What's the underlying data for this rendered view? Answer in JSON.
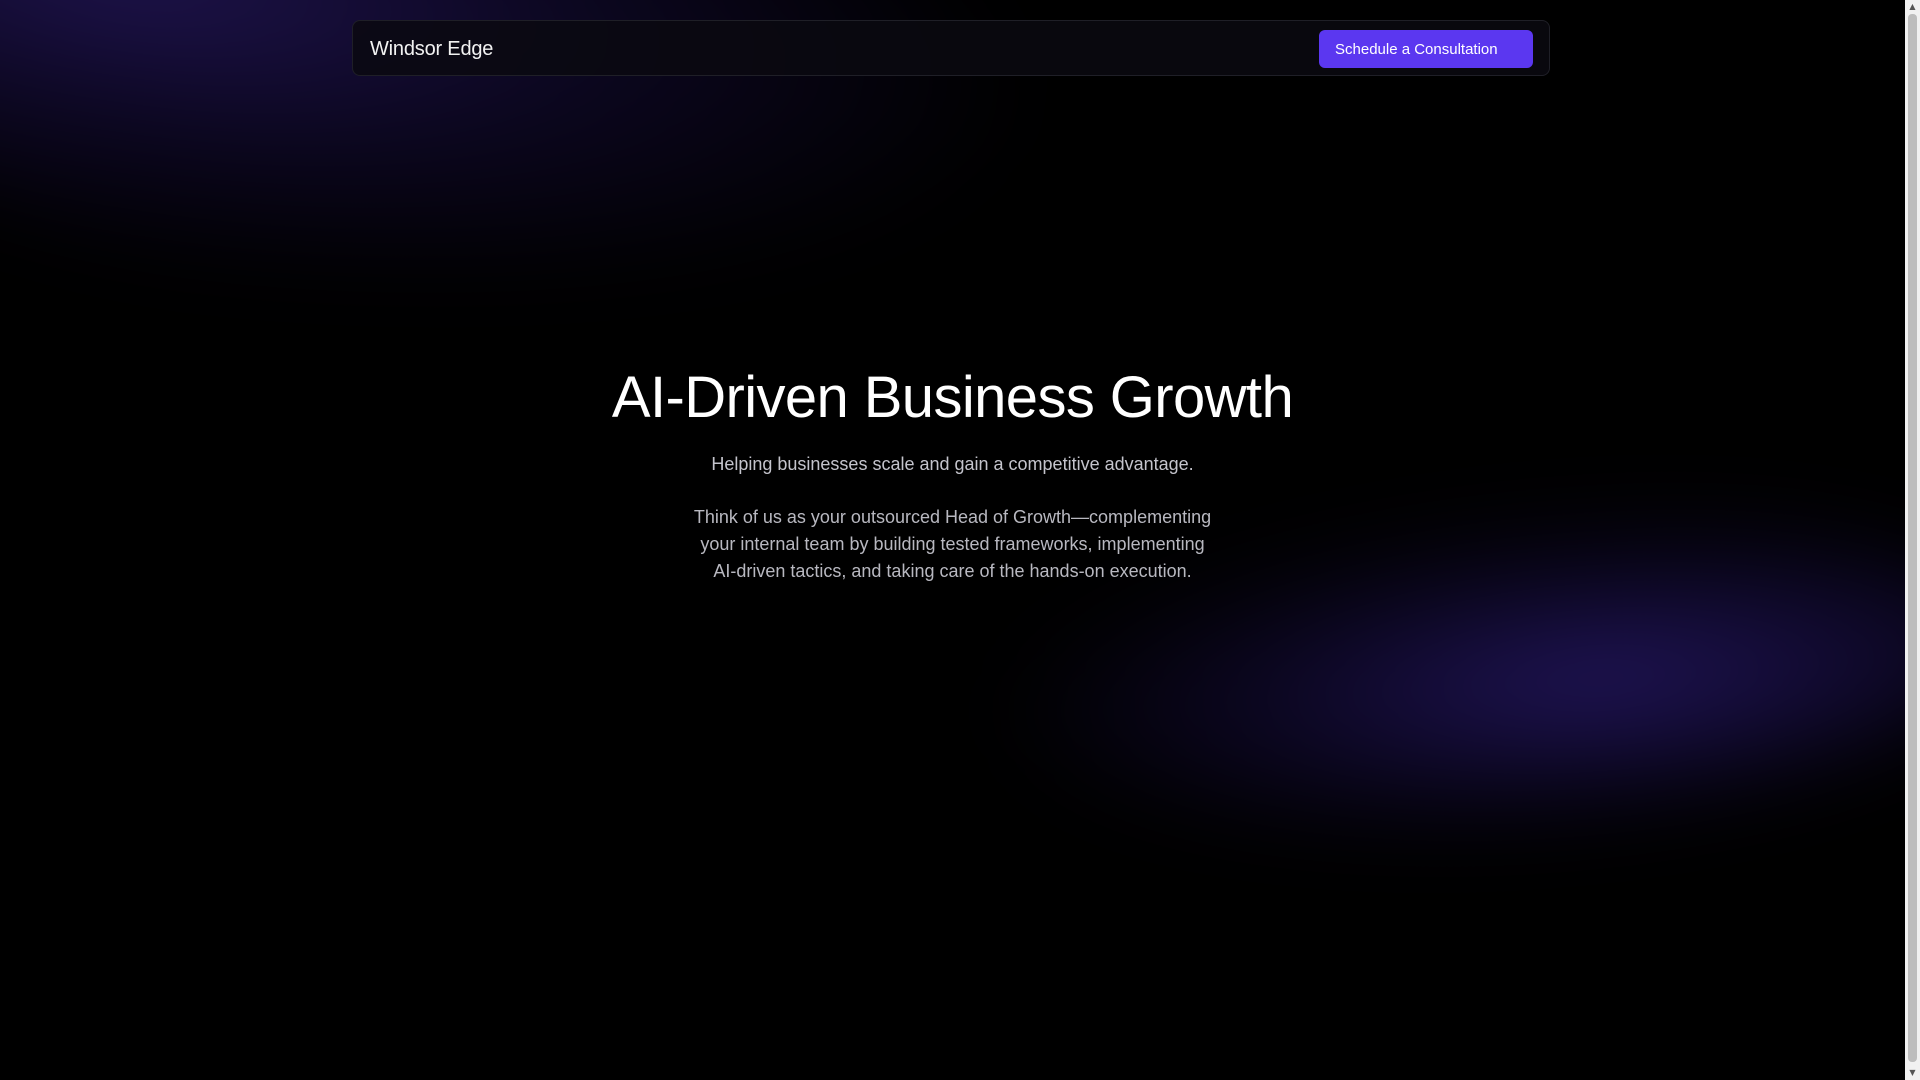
{
  "navbar": {
    "brand": "Windsor Edge",
    "cta_label": "Schedule a Consultation"
  },
  "hero": {
    "title": "AI-Driven Business Growth",
    "subtitle": "Helping businesses scale and gain a competitive advantage.",
    "body": "Think of us as your outsourced Head of Growth—complementing your internal team by building tested frameworks, implementing AI-driven tactics, and taking care of the hands-on execution."
  },
  "scrollbar": {
    "up_icon": "scroll-up-arrow-icon",
    "down_icon": "scroll-down-arrow-icon",
    "up_glyph": "▲",
    "down_glyph": "▼"
  },
  "colors": {
    "background": "#000000",
    "accent": "#5b37f0",
    "glow": "#37238c",
    "text_primary": "#ffffff",
    "text_secondary": "#c4c4cc"
  }
}
